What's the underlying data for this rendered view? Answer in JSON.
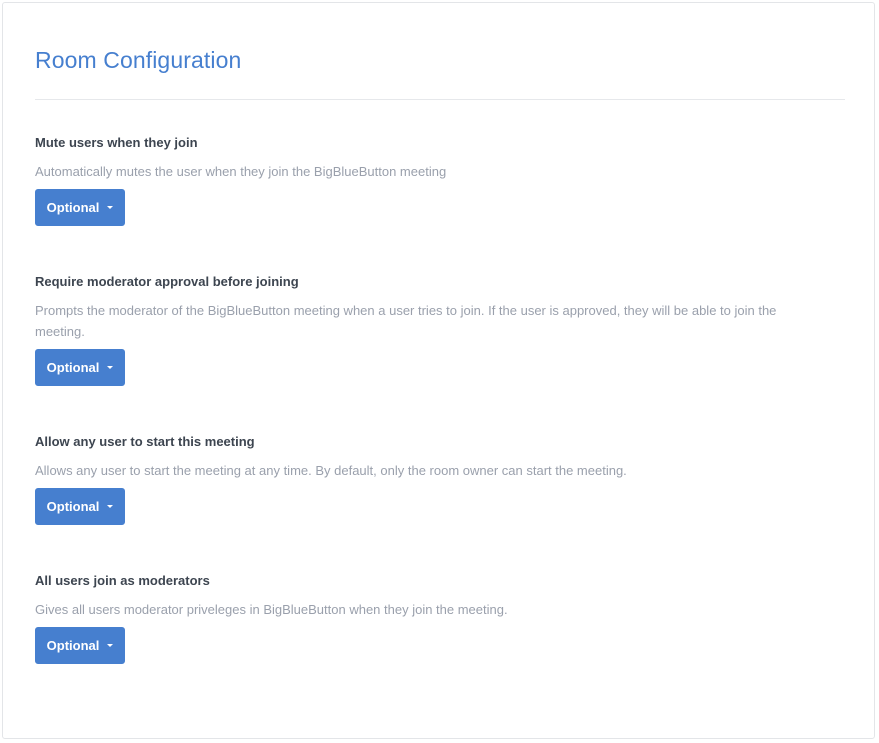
{
  "panel": {
    "title": "Room Configuration"
  },
  "settings": [
    {
      "label": "Mute users when they join",
      "description": "Automatically mutes the user when they join the BigBlueButton meeting",
      "value": "Optional"
    },
    {
      "label": "Require moderator approval before joining",
      "description": "Prompts the moderator of the BigBlueButton meeting when a user tries to join. If the user is approved, they will be able to join the meeting.",
      "value": "Optional"
    },
    {
      "label": "Allow any user to start this meeting",
      "description": "Allows any user to start the meeting at any time. By default, only the room owner can start the meeting.",
      "value": "Optional"
    },
    {
      "label": "All users join as moderators",
      "description": "Gives all users moderator priveleges in BigBlueButton when they join the meeting.",
      "value": "Optional"
    }
  ],
  "colors": {
    "accent": "#467fcf",
    "muted_text": "#9aa0ac",
    "label_text": "#3d4550"
  },
  "icons": {
    "dropdown": "caret-down-icon"
  }
}
